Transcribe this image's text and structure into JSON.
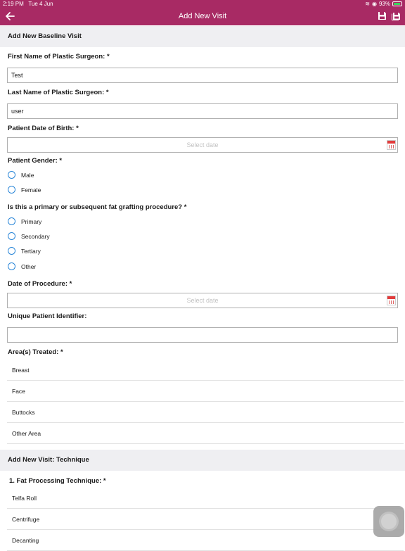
{
  "status_bar": {
    "time": "2:19 PM",
    "date": "Tue 4 Jun",
    "battery": "93%"
  },
  "nav": {
    "title": "Add New Visit"
  },
  "sections": {
    "baseline": "Add New Baseline Visit",
    "technique": "Add New Visit: Technique"
  },
  "form": {
    "first_name_label": "First Name of Plastic Surgeon: *",
    "first_name_value": "Test",
    "last_name_label": "Last Name of Plastic Surgeon: *",
    "last_name_value": "user",
    "dob_label": "Patient Date of Birth: *",
    "dob_placeholder": "Select date",
    "gender_label": "Patient Gender: *",
    "gender_options": [
      "Male",
      "Female"
    ],
    "procedure_type_label": "Is this a primary or subsequent fat grafting procedure? *",
    "procedure_type_options": [
      "Primary",
      "Secondary",
      "Tertiary",
      "Other"
    ],
    "procedure_date_label": "Date of Procedure: *",
    "procedure_date_placeholder": "Select date",
    "upi_label": "Unique Patient Identifier:",
    "upi_value": "",
    "areas_label": "Area(s) Treated: *",
    "areas": [
      "Breast",
      "Face",
      "Buttocks",
      "Other Area"
    ],
    "fat_processing_label": "1. Fat Processing Technique: *",
    "fat_processing_options": [
      "Telfa Roll",
      "Centrifuge",
      "Decanting"
    ]
  },
  "icons": {
    "back": "arrow-left-icon",
    "save": "floppy-disk-icon",
    "save_all": "floppy-disk-stack-icon",
    "calendar": "calendar-icon",
    "assistive": "assistive-touch-icon"
  },
  "colors": {
    "brand": "#a82a64",
    "radio": "#2a86d8",
    "section_bg": "#efeff2"
  }
}
